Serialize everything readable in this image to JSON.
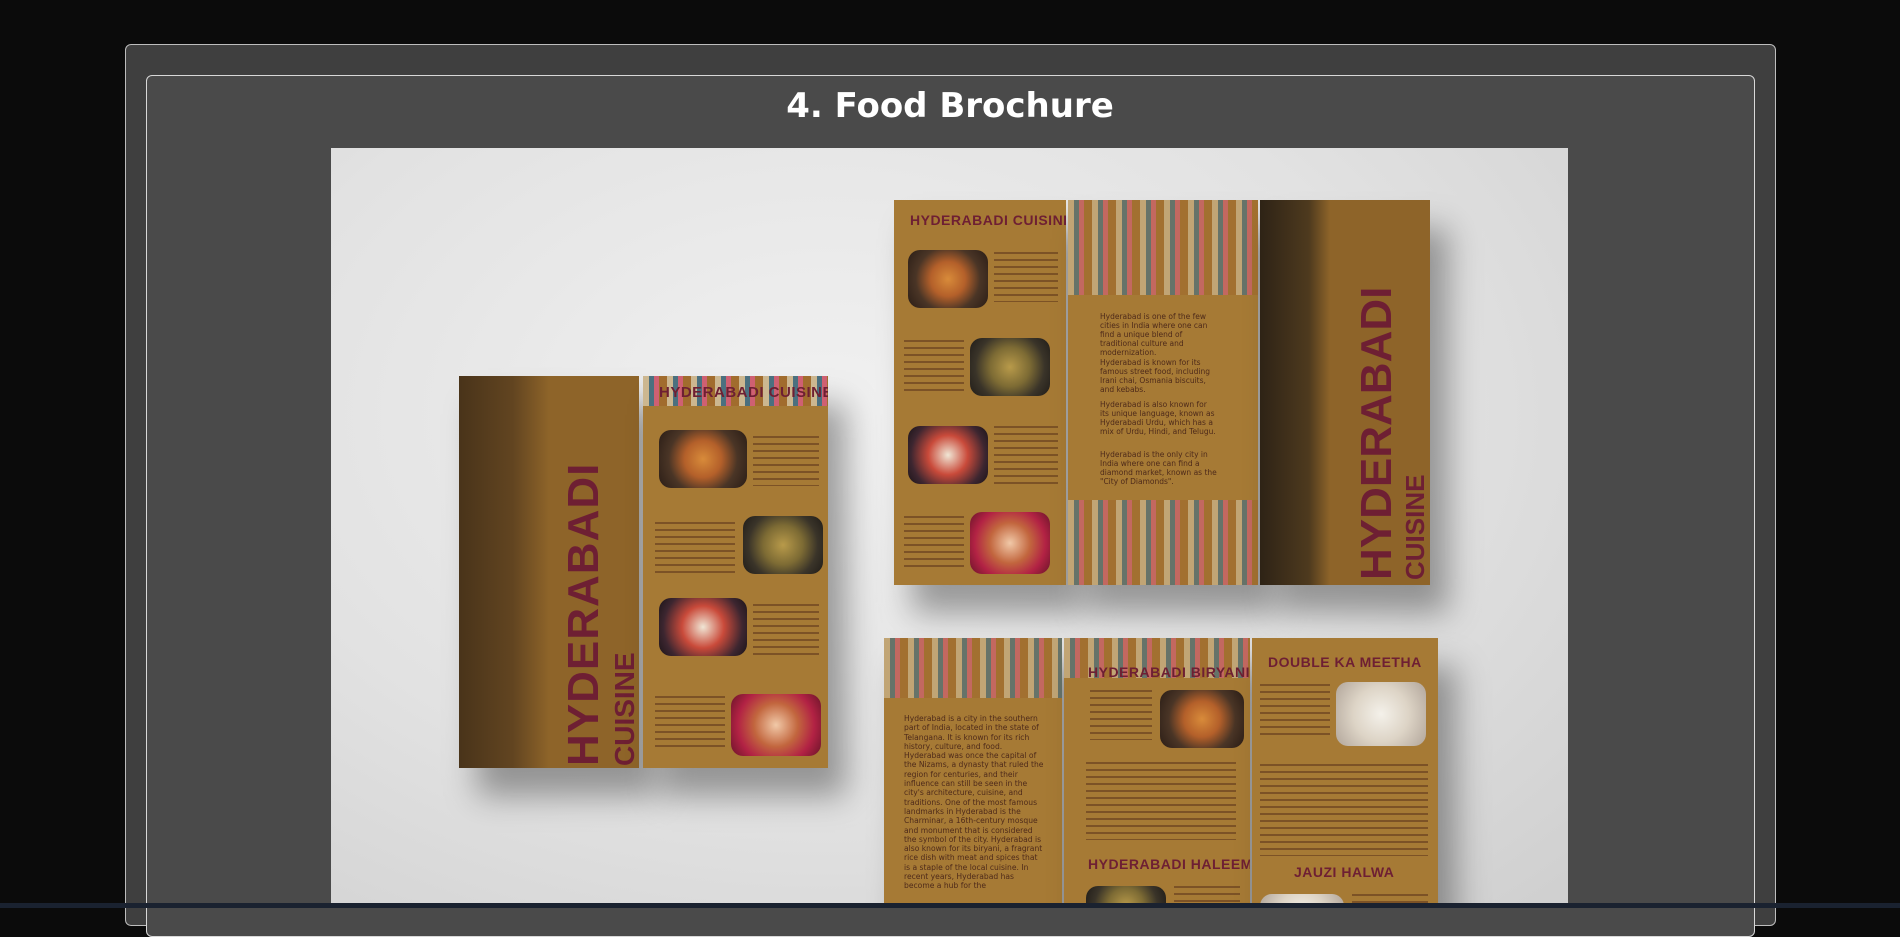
{
  "section": {
    "title": "4. Food Brochure"
  },
  "brochure": {
    "left_cover_line1": "HYDERABADI",
    "left_cover_line2": "CUISINE",
    "left_menu_heading": "HYDERABADI CUISINE",
    "left_items": [
      "Hyderabadi Biryani",
      "Hyderabadi Haleem",
      "Double Ka Meetha",
      "Jauzi Halwa"
    ],
    "top_menu_heading": "HYDERABADI CUISINE",
    "top_items": [
      "Hyderabadi Biryani",
      "Hyderabadi Haleem",
      "Double Ka Meetha",
      "Jauzi Halwa"
    ],
    "top_paragraphs": [
      "Hyderabad is one of the few cities in India where one can find a unique blend of traditional culture and modernization.",
      "Hyderabad is known for its famous street food, including Irani chai, Osmania biscuits, and kebabs.",
      "Hyderabad is also known for its unique language, known as Hyderabadi Urdu, which has a mix of Urdu, Hindi, and Telugu.",
      "Hyderabad is the only city in India where one can find a diamond market, known as the \"City of Diamonds\"."
    ],
    "top_cover_line1": "HYDERABADI",
    "top_cover_line2": "CUISINE",
    "bottom_intro": "Hyderabad is a city in the southern part of India, located in the state of Telangana. It is known for its rich history, culture, and food. Hyderabad was once the capital of the Nizams, a dynasty that ruled the region for centuries, and their influence can still be seen in the city's architecture, cuisine, and traditions. One of the most famous landmarks in Hyderabad is the Charminar, a 16th-century mosque and monument that is considered the symbol of the city. Hyderabad is also known for its biryani, a fragrant rice dish with meat and spices that is a staple of the local cuisine. In recent years, Hyderabad has become a hub for the",
    "bottom_heading_biryani": "HYDERABADI BIRYANI",
    "bottom_heading_meetha": "DOUBLE KA MEETHA",
    "bottom_heading_haleem": "HYDERABADI HALEEM",
    "bottom_heading_halwa": "JAUZI HALWA"
  }
}
